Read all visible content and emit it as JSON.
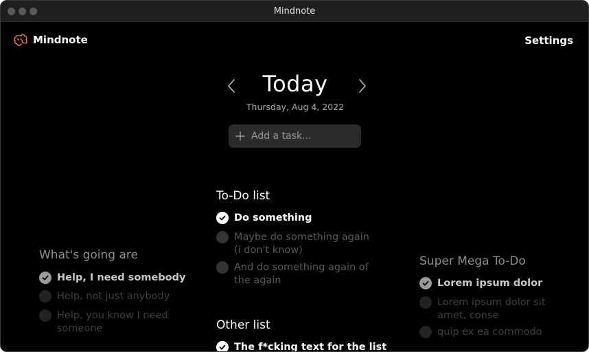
{
  "window": {
    "title": "Mindnote"
  },
  "header": {
    "brand": "Mindnote",
    "settings_label": "Settings"
  },
  "day": {
    "title": "Today",
    "date": "Thursday, Aug 4, 2022"
  },
  "add_task": {
    "placeholder": "Add a task..."
  },
  "lists": {
    "todo": {
      "title": "To-Do list",
      "items": [
        {
          "text": "Do something",
          "done": true
        },
        {
          "line1": "Maybe do something again",
          "line2": "(i don't know)",
          "done": false
        },
        {
          "line1": "And do something again of",
          "line2": "the again",
          "done": false
        }
      ]
    },
    "other": {
      "title": "Other list",
      "items": [
        {
          "text": "The f*cking text for the list",
          "done": true
        }
      ]
    },
    "left": {
      "title": "What's going are",
      "items": [
        {
          "text": "Help, I need somebody",
          "done": true
        },
        {
          "text": "Help, not just anybody",
          "done": false
        },
        {
          "line1": "Help, you know I need",
          "line2": "someone",
          "done": false
        }
      ]
    },
    "right": {
      "title": "Super Mega To-Do",
      "items": [
        {
          "text": "Lorem ipsum dolor",
          "done": true
        },
        {
          "line1": "Lorem ipsum dolor sit",
          "line2": "amet, conse",
          "done": false
        },
        {
          "text": "quip ex ea commodo",
          "done": false
        }
      ]
    }
  },
  "colors": {
    "background": "#000000",
    "accent": "#e8734a",
    "input_bg": "#2b2b2b"
  },
  "icons": {
    "brand": "brain-icon",
    "prev": "chevron-left-icon",
    "next": "chevron-right-icon",
    "add": "plus-icon",
    "check": "check-icon"
  }
}
